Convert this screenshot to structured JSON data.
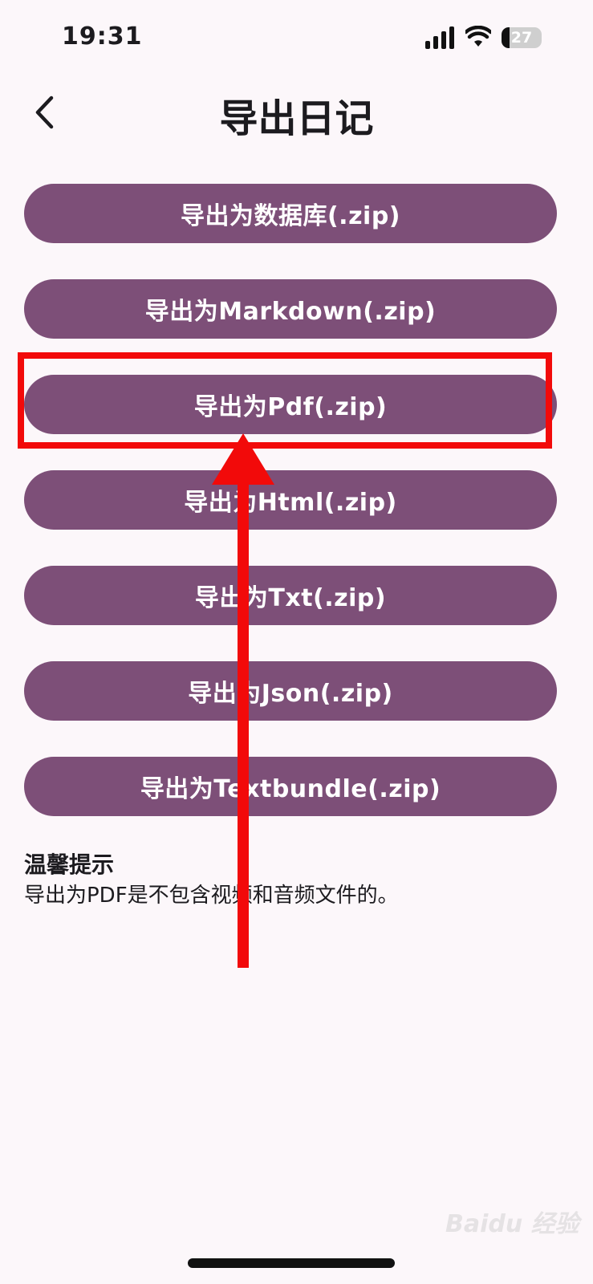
{
  "status_bar": {
    "time": "19:31",
    "battery_level": "27",
    "icons": [
      "signal-icon",
      "wifi-icon",
      "battery-icon"
    ]
  },
  "header": {
    "title": "导出日记",
    "back_icon": "chevron-left-icon"
  },
  "export_buttons": [
    {
      "label": "导出为数据库(.zip)"
    },
    {
      "label": "导出为Markdown(.zip)"
    },
    {
      "label": "导出为Pdf(.zip)"
    },
    {
      "label": "导出为Html(.zip)"
    },
    {
      "label": "导出为Txt(.zip)"
    },
    {
      "label": "导出为Json(.zip)"
    },
    {
      "label": "导出为Textbundle(.zip)"
    }
  ],
  "tip": {
    "title": "温馨提示",
    "text": "导出为PDF是不包含视频和音频文件的。"
  },
  "watermark": "Baidu 经验",
  "colors": {
    "background": "#fcf7fa",
    "button": "#7d4f78",
    "button_text": "#ffffff",
    "annotation": "#f20a0a"
  }
}
